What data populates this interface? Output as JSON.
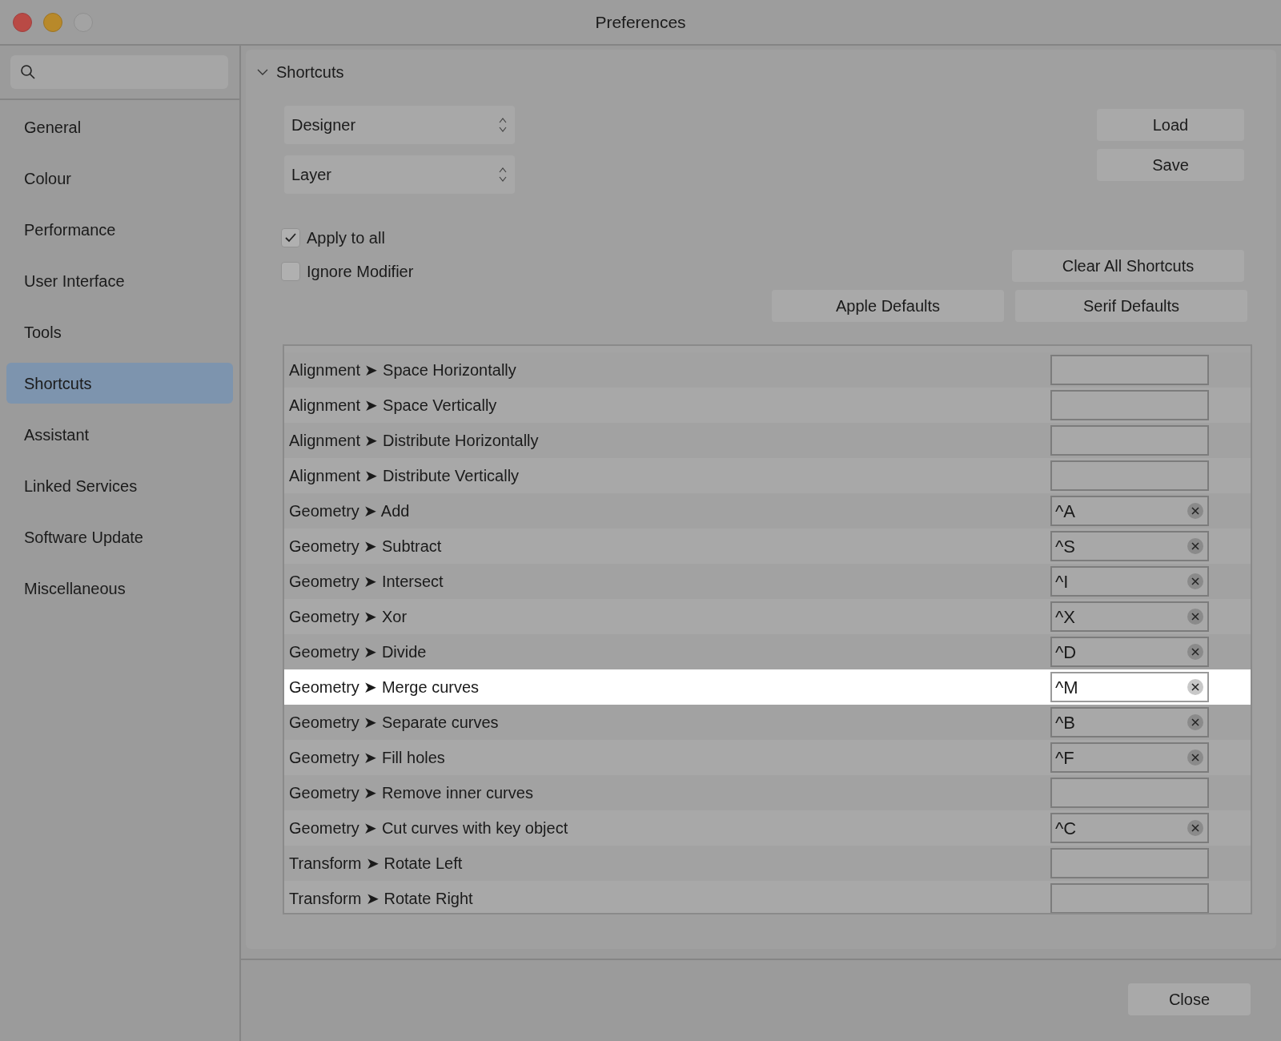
{
  "window": {
    "title": "Preferences"
  },
  "sidebar": {
    "items": [
      {
        "label": "General",
        "selected": false
      },
      {
        "label": "Colour",
        "selected": false
      },
      {
        "label": "Performance",
        "selected": false
      },
      {
        "label": "User Interface",
        "selected": false
      },
      {
        "label": "Tools",
        "selected": false
      },
      {
        "label": "Shortcuts",
        "selected": true
      },
      {
        "label": "Assistant",
        "selected": false
      },
      {
        "label": "Linked Services",
        "selected": false
      },
      {
        "label": "Software Update",
        "selected": false
      },
      {
        "label": "Miscellaneous",
        "selected": false
      }
    ]
  },
  "section": {
    "title": "Shortcuts",
    "expanded": true,
    "dropdowns": [
      {
        "value": "Designer"
      },
      {
        "value": "Layer"
      }
    ],
    "checkboxes": [
      {
        "label": "Apply to all",
        "checked": true
      },
      {
        "label": "Ignore Modifier",
        "checked": false
      }
    ],
    "buttons": {
      "load": "Load",
      "save": "Save",
      "clear": "Clear All Shortcuts",
      "apple_defaults": "Apple Defaults",
      "serif_defaults": "Serif Defaults"
    },
    "rows": [
      {
        "label": "Alignment ➤ Space Horizontally",
        "shortcut": "",
        "selected": false
      },
      {
        "label": "Alignment ➤ Space Vertically",
        "shortcut": "",
        "selected": false
      },
      {
        "label": "Alignment ➤ Distribute Horizontally",
        "shortcut": "",
        "selected": false
      },
      {
        "label": "Alignment ➤ Distribute Vertically",
        "shortcut": "",
        "selected": false
      },
      {
        "label": "Geometry ➤ Add",
        "shortcut": "^A",
        "selected": false
      },
      {
        "label": "Geometry ➤ Subtract",
        "shortcut": "^S",
        "selected": false
      },
      {
        "label": "Geometry ➤ Intersect",
        "shortcut": "^I",
        "selected": false
      },
      {
        "label": "Geometry ➤ Xor",
        "shortcut": "^X",
        "selected": false
      },
      {
        "label": "Geometry ➤ Divide",
        "shortcut": "^D",
        "selected": false
      },
      {
        "label": "Geometry ➤ Merge curves",
        "shortcut": "^M",
        "selected": true
      },
      {
        "label": "Geometry ➤ Separate curves",
        "shortcut": "^B",
        "selected": false
      },
      {
        "label": "Geometry ➤ Fill holes",
        "shortcut": "^F",
        "selected": false
      },
      {
        "label": "Geometry ➤ Remove inner curves",
        "shortcut": "",
        "selected": false
      },
      {
        "label": "Geometry ➤ Cut curves with key object",
        "shortcut": "^C",
        "selected": false
      },
      {
        "label": "Transform ➤ Rotate Left",
        "shortcut": "",
        "selected": false
      },
      {
        "label": "Transform ➤ Rotate Right",
        "shortcut": "",
        "selected": false
      }
    ]
  },
  "footer": {
    "close": "Close"
  }
}
